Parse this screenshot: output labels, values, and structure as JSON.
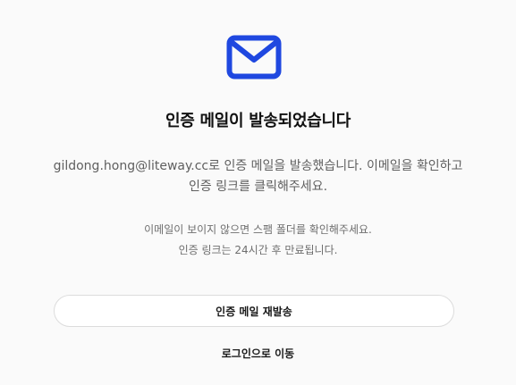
{
  "icon": {
    "name": "mail-icon",
    "color": "#1f48e0"
  },
  "title": "인증 메일이 발송되었습니다",
  "description": "gildong.hong@liteway.cc로 인증 메일을 발송했습니다. 이메일을 확인하고 인증 링크를 클릭해주세요.",
  "notice": {
    "line1": "이메일이 보이지 않으면 스팸 폴더를 확인해주세요.",
    "line2": "인증 링크는 24시간 후 만료됩니다."
  },
  "actions": {
    "resend_label": "인증 메일 재발송",
    "login_label": "로그인으로 이동"
  }
}
